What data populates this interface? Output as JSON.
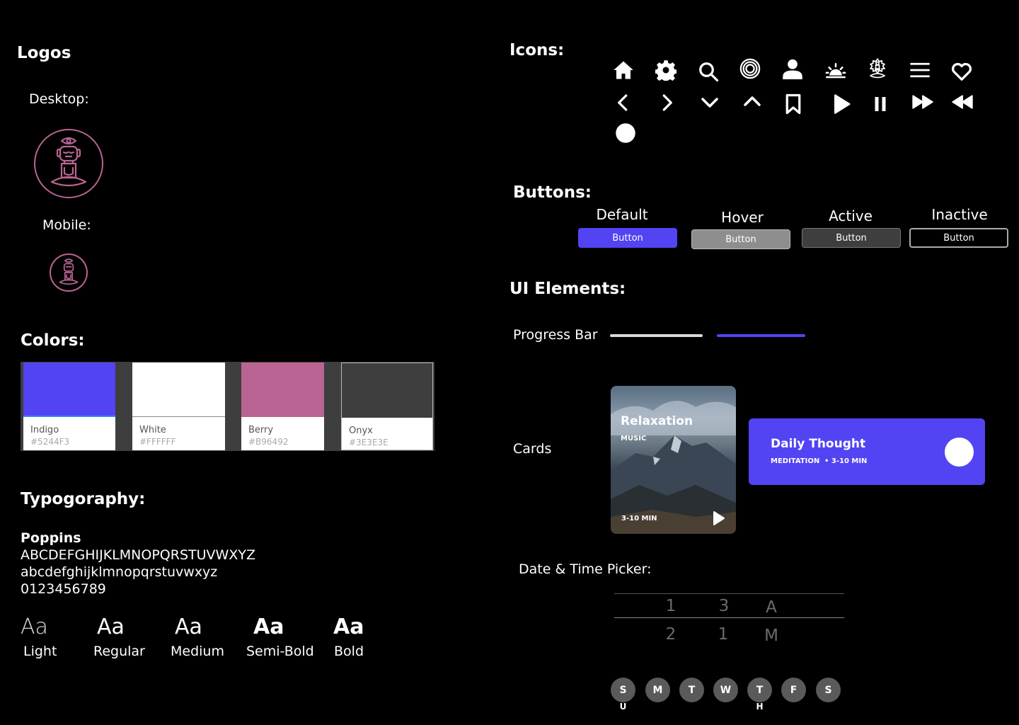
{
  "logos": {
    "title": "Logos",
    "desktop_label": "Desktop:",
    "mobile_label": "Mobile:"
  },
  "colors": {
    "title": "Colors:",
    "swatches": [
      {
        "name": "Indigo",
        "hex": "#5244F3"
      },
      {
        "name": "White",
        "hex": "#FFFFFF"
      },
      {
        "name": "Berry",
        "hex": "#B96492"
      },
      {
        "name": "Onyx",
        "hex": "#3E3E3E"
      }
    ]
  },
  "typography": {
    "title": "Typogoraphy:",
    "font_name": "Poppins",
    "upper": "ABCDEFGHIJKLMNOPQRSTUVWXYZ",
    "lower": "abcdefghijklmnopqrstuvwxyz",
    "digits": "0123456789",
    "sample": "Aa",
    "weights": [
      "Light",
      "Regular",
      "Medium",
      "Semi-Bold",
      "Bold"
    ]
  },
  "icons": {
    "title": "Icons:",
    "list": [
      "home-icon",
      "gear-icon",
      "search-icon",
      "target-icon",
      "user-icon",
      "sunrise-icon",
      "meditation-icon",
      "menu-icon",
      "heart-icon",
      "chevron-left-icon",
      "chevron-right-icon",
      "chevron-down-icon",
      "chevron-up-icon",
      "bookmark-icon",
      "play-icon",
      "pause-icon",
      "fast-forward-icon",
      "rewind-icon",
      "circle-icon"
    ]
  },
  "buttons": {
    "title": "Buttons:",
    "states": [
      {
        "state": "Default",
        "label": "Button"
      },
      {
        "state": "Hover",
        "label": "Button"
      },
      {
        "state": "Active",
        "label": "Button"
      },
      {
        "state": "Inactive",
        "label": "Button"
      }
    ]
  },
  "ui": {
    "title": "UI Elements:",
    "progress_label": "Progress Bar",
    "cards_label": "Cards",
    "card_image": {
      "title": "Relaxation",
      "subtitle": "MUSIC",
      "duration": "3-10 MIN"
    },
    "card_blue": {
      "title": "Daily Thought",
      "category": "MEDITATION",
      "duration": "• 3-10 MIN"
    },
    "picker_label": "Date & Time Picker:",
    "picker": {
      "row1": [
        "1",
        "3",
        "A"
      ],
      "row2": [
        "2",
        "1",
        "M"
      ]
    },
    "days": [
      "S",
      "M",
      "T",
      "W",
      "T",
      "F",
      "S"
    ],
    "day_subs": [
      "U",
      "H"
    ]
  }
}
